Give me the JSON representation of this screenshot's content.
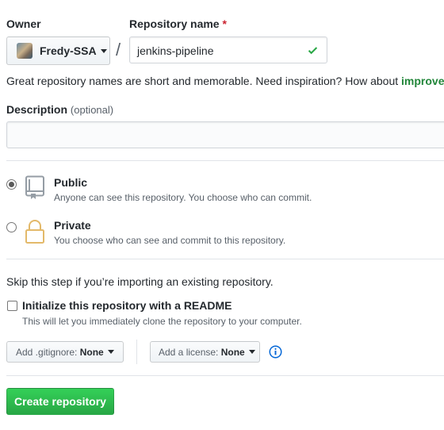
{
  "owner": {
    "label": "Owner",
    "selected": "Fredy-SSA"
  },
  "separator": "/",
  "repo_name": {
    "label": "Repository name",
    "required_mark": "*",
    "value": "jenkins-pipeline"
  },
  "suggestion": {
    "text": "Great repository names are short and memorable. Need inspiration? How about ",
    "link": "improved"
  },
  "description": {
    "label": "Description",
    "optional": "(optional)",
    "value": ""
  },
  "visibility": {
    "public": {
      "title": "Public",
      "note": "Anyone can see this repository. You choose who can commit.",
      "checked": true
    },
    "private": {
      "title": "Private",
      "note": "You choose who can see and commit to this repository.",
      "checked": false
    }
  },
  "import_note": "Skip this step if you’re importing an existing repository.",
  "readme": {
    "label": "Initialize this repository with a README",
    "note": "This will let you immediately clone the repository to your computer.",
    "checked": false
  },
  "gitignore": {
    "prefix": "Add .gitignore:",
    "value": "None"
  },
  "license": {
    "prefix": "Add a license:",
    "value": "None"
  },
  "create_button": "Create repository",
  "colors": {
    "primary": "#2ea44f",
    "success_check": "#28a745",
    "link_green": "#22863a",
    "info_blue": "#0366d6"
  }
}
